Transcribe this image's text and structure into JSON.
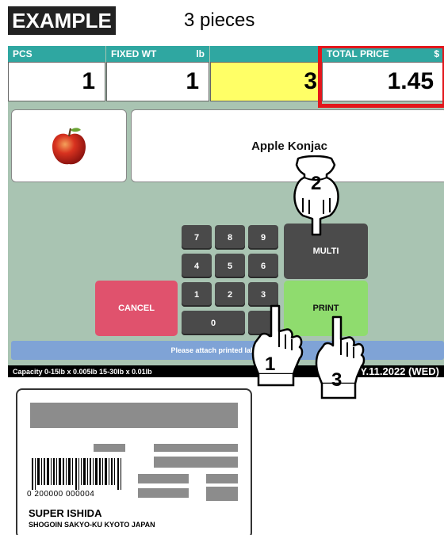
{
  "example_label": "EXAMPLE",
  "caption": "3 pieces",
  "header": {
    "pcs_label": "PCS",
    "fixed_wt_label": "FIXED WT",
    "fixed_wt_unit": "lb",
    "total_price_label": "TOTAL PRICE",
    "total_price_unit": "$"
  },
  "values": {
    "pcs": "1",
    "fixed_wt": "1",
    "count": "3",
    "total_price": "1.45"
  },
  "product": {
    "name": "Apple Konjac",
    "image_icon": "apple-icon"
  },
  "keypad": {
    "keys": [
      "7",
      "8",
      "9",
      "4",
      "5",
      "6",
      "1",
      "2",
      "3",
      "0"
    ],
    "multi": "MULTI",
    "cancel": "CANCEL",
    "print": "PRINT"
  },
  "message": "Please attach printed label to bag",
  "status": {
    "capacity": "Capacity 0-15lb x 0.005lb  15-30lb x 0.01lb",
    "date": "Y.11.2022 (WED)"
  },
  "label_sample": {
    "barcode_digits": "0  200000  000004",
    "store_name": "SUPER  ISHIDA",
    "store_address": "SHOGOIN  SAKYO-KU  KYOTO  JAPAN"
  },
  "steps": [
    "1",
    "2",
    "3"
  ],
  "colors": {
    "header": "#2fa7a1",
    "highlight": "#e3161b",
    "yellow_field": "#ffff66",
    "cancel": "#e0526d",
    "print": "#8fdc6e",
    "screen_bg": "#a9c4b2"
  }
}
